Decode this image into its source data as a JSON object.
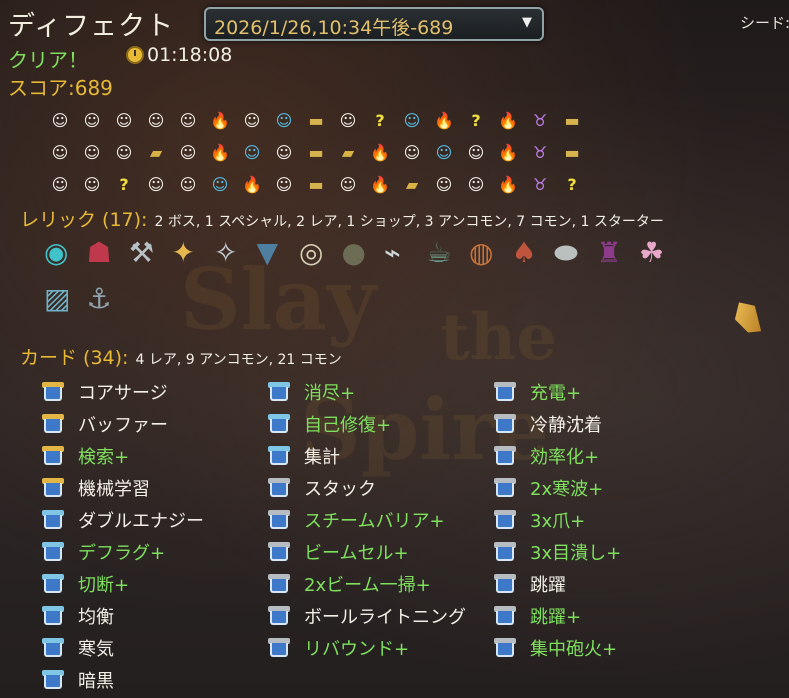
{
  "header": {
    "title": "ディフェクト",
    "run_select": "2026/1/26,10:34午後-689",
    "seed_label": "シード:"
  },
  "result": {
    "status": "クリア！",
    "time": "01:18:08",
    "score": "スコア:689"
  },
  "map": {
    "rows": [
      [
        "monster",
        "monster",
        "monster",
        "monster",
        "monster",
        "elite",
        "monster",
        "shop",
        "chest",
        "monster",
        "unknown",
        "shop",
        "elite",
        "unknown",
        "elite",
        "boss",
        "chest"
      ],
      [
        "monster",
        "monster",
        "monster",
        "rest",
        "monster",
        "elite",
        "shop",
        "monster",
        "chest",
        "rest",
        "elite",
        "monster",
        "shop",
        "monster",
        "elite",
        "boss",
        "chest"
      ],
      [
        "monster",
        "monster",
        "unknown",
        "monster",
        "monster",
        "shop",
        "elite",
        "monster",
        "chest",
        "monster",
        "elite",
        "rest",
        "monster",
        "monster",
        "elite",
        "boss",
        "unknown"
      ]
    ],
    "icon_glyphs": {
      "monster": "☺",
      "elite": "🔥",
      "unknown": "?",
      "shop": "☺",
      "chest": "▬",
      "rest": "▰",
      "boss": "♉"
    }
  },
  "relics": {
    "title": "レリック (17):",
    "detail": "2 ボス, 1 スペシャル, 2 レア, 1 ショップ, 3 アンコモン, 7 コモン, 1 スターター",
    "items": [
      {
        "name": "cracked-core",
        "glyph": "◉",
        "color": "#3fc3c9"
      },
      {
        "name": "runic-dome",
        "glyph": "☗",
        "color": "#c0384b"
      },
      {
        "name": "shovel",
        "glyph": "⚒",
        "color": "#b7c2c7"
      },
      {
        "name": "golden-wings",
        "glyph": "✦",
        "color": "#e5b94f"
      },
      {
        "name": "shuriken",
        "glyph": "✧",
        "color": "#c8d0d6"
      },
      {
        "name": "toolbox-monster",
        "glyph": "▼",
        "color": "#4e7fa0"
      },
      {
        "name": "orbit-ring",
        "glyph": "◎",
        "color": "#d7d0b5"
      },
      {
        "name": "egg",
        "glyph": "●",
        "color": "#6d6d56"
      },
      {
        "name": "fish-bones",
        "glyph": "⌁",
        "color": "#d0d8dc"
      },
      {
        "name": "teapot",
        "glyph": "☕",
        "color": "#6a9a8a"
      },
      {
        "name": "pie",
        "glyph": "◍",
        "color": "#c9733a"
      },
      {
        "name": "meat",
        "glyph": "♠",
        "color": "#c0553e"
      },
      {
        "name": "stone",
        "glyph": "⬬",
        "color": "#b9c0bd"
      },
      {
        "name": "cauldron",
        "glyph": "♜",
        "color": "#8d3c8d"
      },
      {
        "name": "turnip",
        "glyph": "☘",
        "color": "#e6a7c8"
      },
      {
        "name": "treasure-map",
        "glyph": "▨",
        "color": "#6fb3c9"
      },
      {
        "name": "anchor",
        "glyph": "⚓",
        "color": "#8ea3ae"
      }
    ]
  },
  "cards": {
    "title": "カード (34):",
    "detail": "4 レア, 9 アンコモン, 21 コモン",
    "columns": [
      [
        {
          "label": "コアサージ",
          "upgraded": false,
          "rarity": "rare"
        },
        {
          "label": "バッファー",
          "upgraded": false,
          "rarity": "rare"
        },
        {
          "label": "検索+",
          "upgraded": true,
          "rarity": "rare"
        },
        {
          "label": "機械学習",
          "upgraded": false,
          "rarity": "rare"
        },
        {
          "label": "ダブルエナジー",
          "upgraded": false,
          "rarity": "uncommon"
        },
        {
          "label": "デフラグ+",
          "upgraded": true,
          "rarity": "uncommon"
        },
        {
          "label": "切断+",
          "upgraded": true,
          "rarity": "uncommon"
        },
        {
          "label": "均衡",
          "upgraded": false,
          "rarity": "uncommon"
        },
        {
          "label": "寒気",
          "upgraded": false,
          "rarity": "uncommon"
        },
        {
          "label": "暗黒",
          "upgraded": false,
          "rarity": "uncommon"
        }
      ],
      [
        {
          "label": "消尽+",
          "upgraded": true,
          "rarity": "uncommon"
        },
        {
          "label": "自己修復+",
          "upgraded": true,
          "rarity": "uncommon"
        },
        {
          "label": "集計",
          "upgraded": false,
          "rarity": "uncommon"
        },
        {
          "label": "スタック",
          "upgraded": false,
          "rarity": "common"
        },
        {
          "label": "スチームバリア+",
          "upgraded": true,
          "rarity": "common"
        },
        {
          "label": "ビームセル+",
          "upgraded": true,
          "rarity": "common"
        },
        {
          "label": "2xビーム一掃+",
          "upgraded": true,
          "rarity": "common"
        },
        {
          "label": "ボールライトニング",
          "upgraded": false,
          "rarity": "common"
        },
        {
          "label": "リバウンド+",
          "upgraded": true,
          "rarity": "common"
        }
      ],
      [
        {
          "label": "充電+",
          "upgraded": true,
          "rarity": "common"
        },
        {
          "label": "冷静沈着",
          "upgraded": false,
          "rarity": "common"
        },
        {
          "label": "効率化+",
          "upgraded": true,
          "rarity": "common"
        },
        {
          "label": "2x寒波+",
          "upgraded": true,
          "rarity": "common"
        },
        {
          "label": "3x爪+",
          "upgraded": true,
          "rarity": "common"
        },
        {
          "label": "3x目潰し+",
          "upgraded": true,
          "rarity": "common"
        },
        {
          "label": "跳躍",
          "upgraded": false,
          "rarity": "common"
        },
        {
          "label": "跳躍+",
          "upgraded": true,
          "rarity": "common"
        },
        {
          "label": "集中砲火+",
          "upgraded": true,
          "rarity": "common"
        }
      ]
    ]
  }
}
